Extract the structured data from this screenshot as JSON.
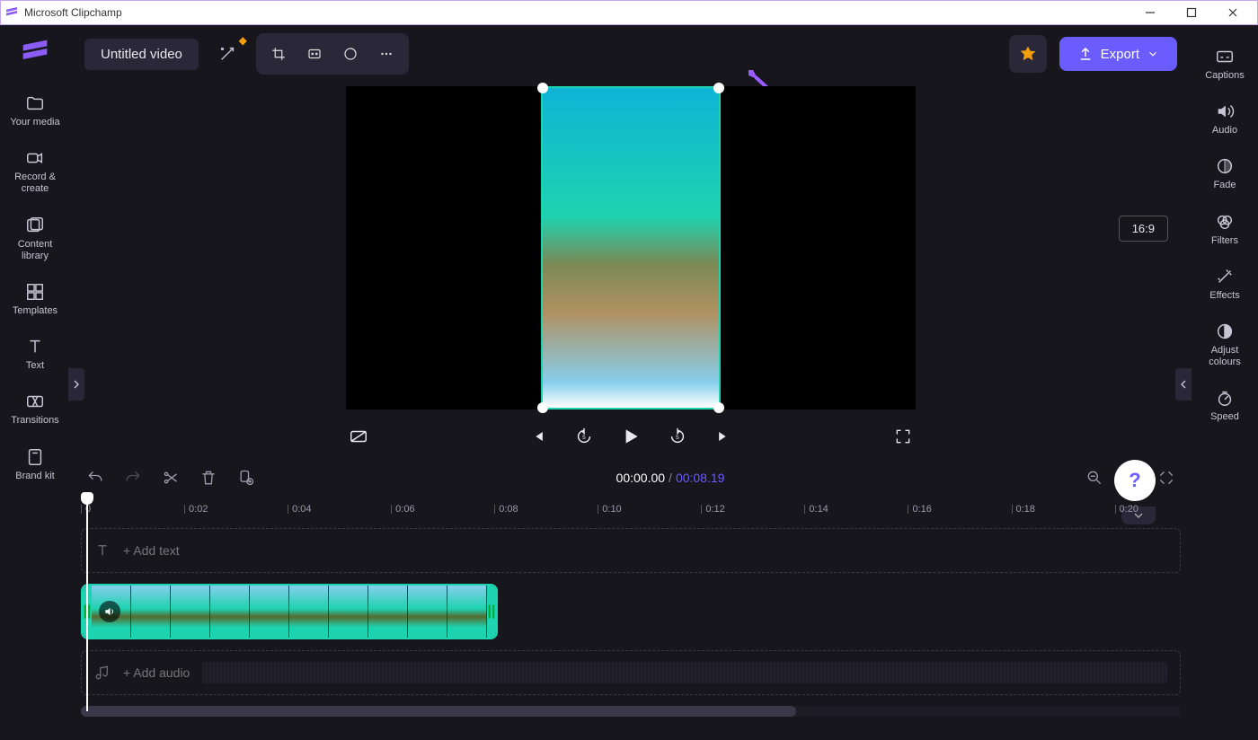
{
  "window": {
    "title": "Microsoft Clipchamp"
  },
  "project": {
    "title": "Untitled video"
  },
  "left_sidebar": [
    {
      "label": "Your media"
    },
    {
      "label": "Record & create"
    },
    {
      "label": "Content library"
    },
    {
      "label": "Templates"
    },
    {
      "label": "Text"
    },
    {
      "label": "Transitions"
    },
    {
      "label": "Brand kit"
    }
  ],
  "right_sidebar": [
    {
      "label": "Captions"
    },
    {
      "label": "Audio"
    },
    {
      "label": "Fade"
    },
    {
      "label": "Filters"
    },
    {
      "label": "Effects"
    },
    {
      "label": "Adjust colours"
    },
    {
      "label": "Speed"
    }
  ],
  "export_label": "Export",
  "aspect_ratio": "16:9",
  "timecode": {
    "current": "00:00.00",
    "duration": "00:08.19"
  },
  "ruler_ticks": [
    "0",
    "0:02",
    "0:04",
    "0:06",
    "0:08",
    "0:10",
    "0:12",
    "0:14",
    "0:16",
    "0:18",
    "0:20"
  ],
  "tracks": {
    "text_placeholder": "+  Add text",
    "audio_placeholder": "+  Add audio"
  }
}
